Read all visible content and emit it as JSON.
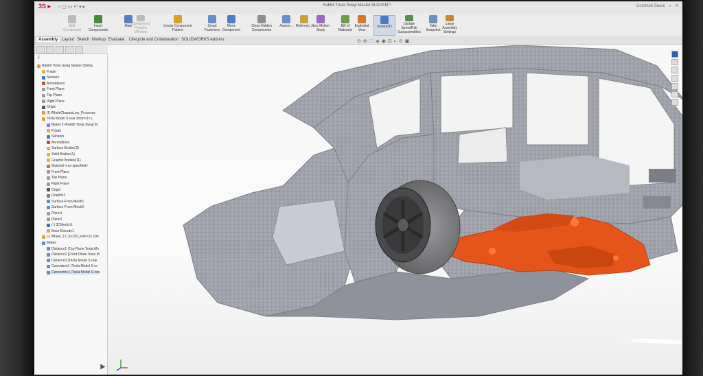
{
  "window": {
    "title": "Rabbit Tesla Swap Master.SLDASM *",
    "search": "Common Searc",
    "close": "X"
  },
  "ribbon": [
    {
      "label": "Edit Component",
      "disabled": true
    },
    {
      "label": "Insert Components"
    },
    {
      "label": "Mate"
    },
    {
      "label": "Component Preview Window",
      "disabled": true
    },
    {
      "label": "Linear Component Pattern"
    },
    {
      "label": "Smart Fasteners"
    },
    {
      "label": "Move Component"
    },
    {
      "label": "Show Hidden Components"
    },
    {
      "label": "Assem..."
    },
    {
      "label": "Referenc..."
    },
    {
      "label": "New Motion Study"
    },
    {
      "label": "Bill of Materials"
    },
    {
      "label": "Exploded View"
    },
    {
      "label": "Instant3D",
      "selected": true
    },
    {
      "label": "Update SpeedPak Subassemblies"
    },
    {
      "label": "Take Snapshot"
    },
    {
      "label": "Large Assembly Settings"
    }
  ],
  "tabs": [
    "Assembly",
    "Layout",
    "Sketch",
    "Markup",
    "Evaluate",
    "Lifecycle and Collaboration",
    "SOLIDWORKS Add-Ins"
  ],
  "tree": [
    {
      "label": "Rabbit Tesla Swap Master (Defau",
      "icon": "assembly",
      "level": 0
    },
    {
      "label": "Folder",
      "icon": "folder",
      "level": 1
    },
    {
      "label": "Sensors",
      "icon": "sensor",
      "level": 1
    },
    {
      "label": "Annotations",
      "icon": "annotation",
      "level": 1
    },
    {
      "label": "Front Plane",
      "icon": "plane",
      "level": 1
    },
    {
      "label": "Top Plane",
      "icon": "plane",
      "level": 1
    },
    {
      "label": "Right Plane",
      "icon": "plane",
      "level": 1
    },
    {
      "label": "Origin",
      "icon": "origin",
      "level": 1
    },
    {
      "label": "(f) WholeChassisLow_Processe",
      "icon": "part",
      "level": 1
    },
    {
      "label": "Tesla Model S rear Short<1> (",
      "icon": "part",
      "level": 1
    },
    {
      "label": "Mates in Rabbit Tesla Swap M",
      "icon": "mate",
      "level": 2
    },
    {
      "label": "Folder",
      "icon": "folder",
      "level": 2
    },
    {
      "label": "Sensors",
      "icon": "sensor",
      "level": 2
    },
    {
      "label": "Annotations",
      "icon": "annotation",
      "level": 2
    },
    {
      "label": "Surface Bodies(2)",
      "icon": "folder",
      "level": 2
    },
    {
      "label": "Solid Bodies(1)",
      "icon": "folder",
      "level": 2
    },
    {
      "label": "Graphic Bodies(11)",
      "icon": "folder",
      "level": 2
    },
    {
      "label": "Material <not specified>",
      "icon": "material",
      "level": 2
    },
    {
      "label": "Front Plane",
      "icon": "plane",
      "level": 2
    },
    {
      "label": "Top Plane",
      "icon": "plane",
      "level": 2
    },
    {
      "label": "Right Plane",
      "icon": "plane",
      "level": 2
    },
    {
      "label": "Origin",
      "icon": "origin",
      "level": 2
    },
    {
      "label": "Graphic1",
      "icon": "graphic",
      "level": 2
    },
    {
      "label": "Surface-From-Mesh1",
      "icon": "surface",
      "level": 2
    },
    {
      "label": "Surface-From-Mesh2",
      "icon": "surface",
      "level": 2
    },
    {
      "label": "Plane1",
      "icon": "plane",
      "level": 2
    },
    {
      "label": "Plane2",
      "icon": "plane",
      "level": 2
    },
    {
      "label": "(-) 3DSketch1",
      "icon": "sketch",
      "level": 2
    },
    {
      "label": "Boss-Extrude1",
      "icon": "feature",
      "level": 2
    },
    {
      "label": "(-) Wheel_17_5x120_et40<1> (De",
      "icon": "part",
      "level": 1
    },
    {
      "label": "Mates",
      "icon": "mate",
      "level": 1
    },
    {
      "label": "Distance1 (Top Plane,Tesla Mo",
      "icon": "mate",
      "level": 2
    },
    {
      "label": "Distance2 (Front Plane,Tesla M",
      "icon": "mate",
      "level": 2
    },
    {
      "label": "Distance3 (Tesla Model S rear",
      "icon": "mate",
      "level": 2
    },
    {
      "label": "Coincident1 (Tesla Model S re",
      "icon": "mate",
      "level": 2
    },
    {
      "label": "Concentric1 (Tesla Model S rea",
      "icon": "mate",
      "level": 2
    }
  ],
  "colors": {
    "mesh": "#9ea1aa",
    "motor": "#e5551a",
    "wheel": "#4a4a4c",
    "tire": "#7f7f82"
  },
  "icons": [
    "sw-logo-icon",
    "home-icon",
    "save-icon",
    "print-icon",
    "undo-icon",
    "filter-icon",
    "search-icon",
    "triad-icon"
  ]
}
